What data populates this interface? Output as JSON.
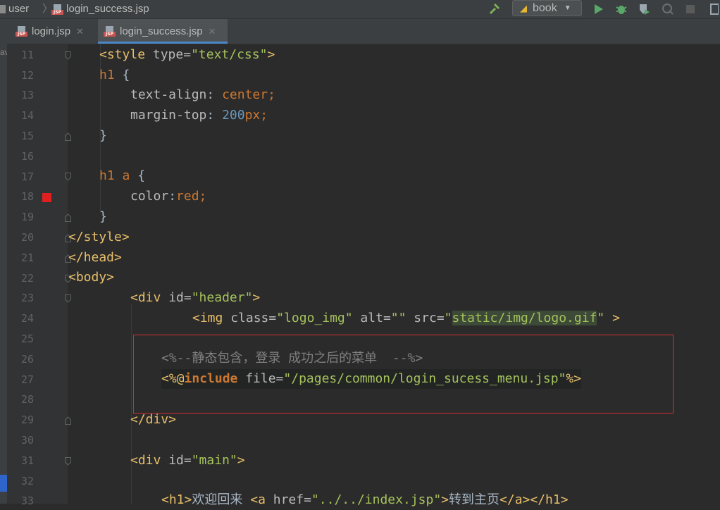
{
  "breadcrumb": {
    "folder": "user",
    "file": "login_success.jsp"
  },
  "run_config": {
    "label": "book"
  },
  "tabs": [
    {
      "label": "login.jsp",
      "active": false
    },
    {
      "label": "login_success.jsp",
      "active": true
    }
  ],
  "left_strip_text": "av",
  "line_numbers": [
    "11",
    "12",
    "13",
    "14",
    "15",
    "16",
    "17",
    "18",
    "19",
    "20",
    "21",
    "22",
    "23",
    "24",
    "25",
    "26",
    "27",
    "28",
    "29",
    "30",
    "31",
    "32",
    "33"
  ],
  "code": {
    "l11": {
      "open": "<",
      "tag": "style",
      "attr": " type=",
      "val": "\"text/css\"",
      "close": ">"
    },
    "l12": {
      "sel": "h1",
      "brace": " {"
    },
    "l13": {
      "prop": "text-align",
      "colon": ": ",
      "value": "center",
      "semi": ";"
    },
    "l14": {
      "prop": "margin-top",
      "colon": ": ",
      "num": "200",
      "unit": "px",
      "semi": ";"
    },
    "l15": {
      "brace": "}"
    },
    "l17": {
      "sel": "h1 a",
      "brace": " {"
    },
    "l18": {
      "prop": "color",
      "colon": ":",
      "value": "red",
      "semi": ";"
    },
    "l19": {
      "brace": "}"
    },
    "l20": {
      "text": "</style>"
    },
    "l21": {
      "text": "</head>"
    },
    "l22": {
      "text": "<body>"
    },
    "l23": {
      "open": "<",
      "tag": "div",
      "attr": " id=",
      "val": "\"header\"",
      "close": ">"
    },
    "l24": {
      "open": "<",
      "tag": "img",
      "attr1": " class=",
      "val1": "\"logo_img\"",
      "attr2": " alt=",
      "val2": "\"\"",
      "attr3": " src=",
      "q1": "\"",
      "path": "static/img/logo.gif",
      "q2": "\"",
      "close": " >"
    },
    "l26": {
      "comment": "<%--静态包含，登录 成功之后的菜单  --%>"
    },
    "l27": {
      "open": "<%@",
      "kw": "include",
      "attr": " file=",
      "q1": "\"",
      "path": "/pages/common/login_sucess_menu.jsp",
      "q2": "\"",
      "close": "%>"
    },
    "l29": {
      "text": "</div>"
    },
    "l31": {
      "open": "<",
      "tag": "div",
      "attr": " id=",
      "val": "\"main\"",
      "close": ">"
    },
    "l33": {
      "open1": "<",
      "tag1": "h1",
      "close1": ">",
      "text": "欢迎回来 ",
      "open2": "<",
      "tag2": "a",
      "attr": " href=",
      "val": "\"../../index.jsp\"",
      "close2": ">",
      "text2": "转到主页",
      "end1": "</a>",
      "end2": "</h1>"
    }
  },
  "colors": {
    "tag": "#e8bf6a",
    "string": "#a5c25c",
    "keyword": "#cc7832",
    "number": "#6897bb",
    "comment": "#808080",
    "breakpoint": "#e02020",
    "highlight_box": "#d32e2e"
  }
}
